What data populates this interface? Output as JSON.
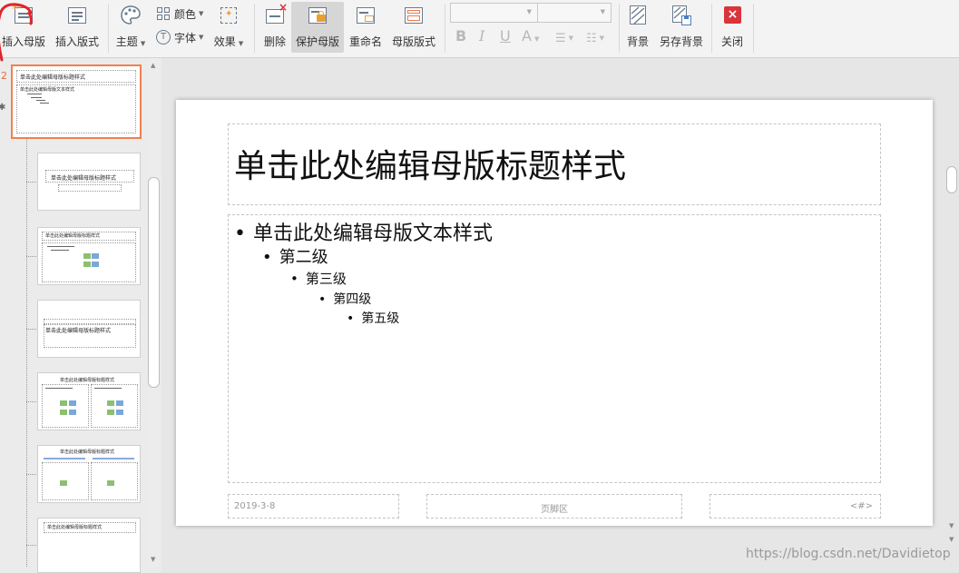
{
  "ribbon": {
    "insert_master": "插入母版",
    "insert_layout": "插入版式",
    "theme": "主题",
    "color": "颜色",
    "font": "字体",
    "effect": "效果",
    "delete": "删除",
    "protect_master": "保护母版",
    "rename": "重命名",
    "master_layout": "母版版式",
    "format_bold": "B",
    "format_italic": "I",
    "format_underline": "U",
    "format_font_color": "A",
    "background": "背景",
    "save_background": "另存背景",
    "close": "关闭"
  },
  "thumbnails": {
    "selected_number": "2",
    "title_text": "单击此处编辑母版标题样式",
    "short_title": "单击此处编辑母版标题样式",
    "body_text": "单击此处编辑母版文本样式"
  },
  "slide": {
    "title": "单击此处编辑母版标题样式",
    "bullets": [
      "单击此处编辑母版文本样式",
      "第二级",
      "第三级",
      "第四级",
      "第五级"
    ],
    "footer_date": "2019-3-8",
    "footer_center": "页脚区",
    "footer_number": "<#>"
  },
  "watermark": "https://blog.csdn.net/Davidietop",
  "colors": {
    "selection": "#f08050",
    "close_red": "#d9343a",
    "annotation_red": "#e0262a"
  }
}
